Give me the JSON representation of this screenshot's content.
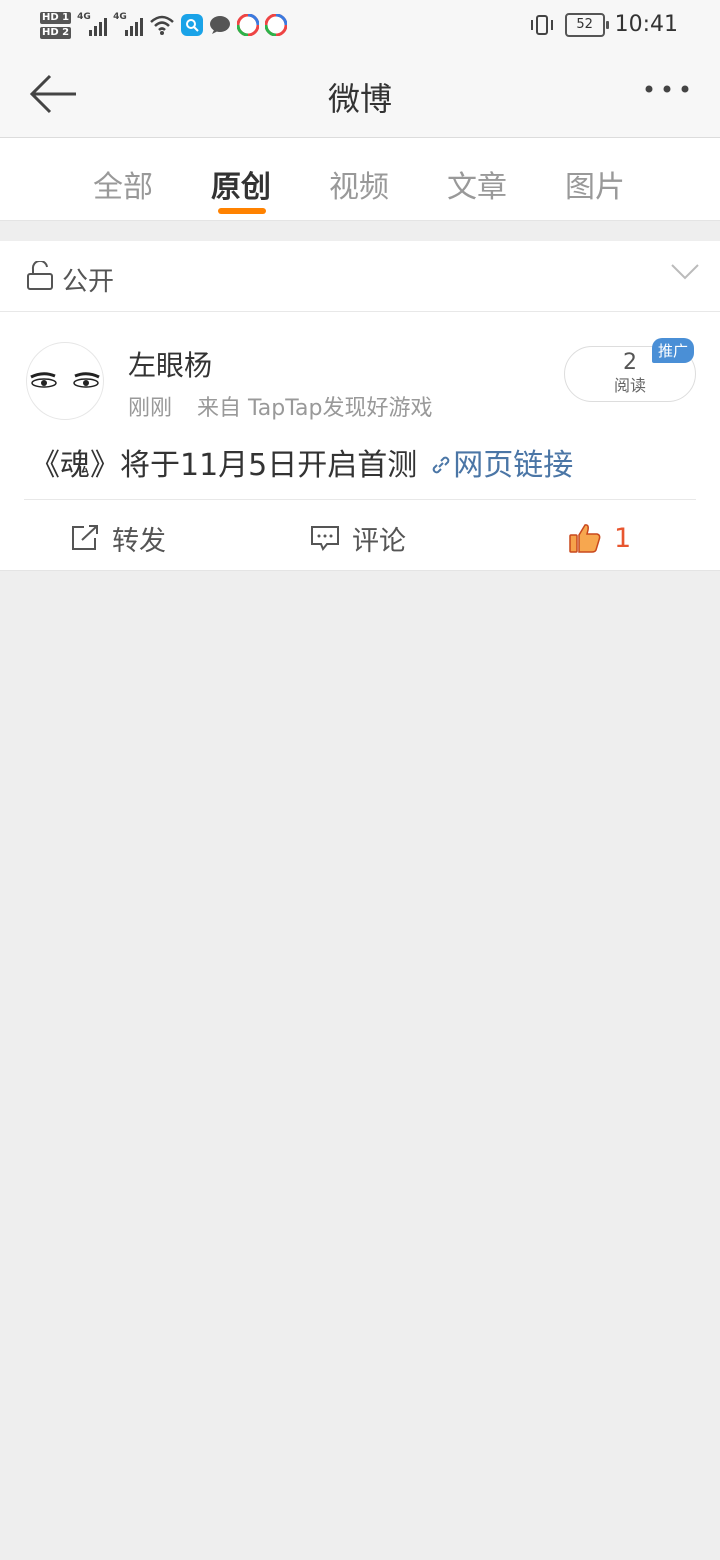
{
  "status_bar": {
    "sim1": "HD 1",
    "sim2": "HD 2",
    "net1": "4G",
    "net2": "4G",
    "battery": "52",
    "time": "10:41"
  },
  "nav": {
    "title": "微博",
    "back_icon": "back-arrow-icon",
    "more_icon": "more-dots-icon"
  },
  "tabs": [
    {
      "label": "全部"
    },
    {
      "label": "原创"
    },
    {
      "label": "视频"
    },
    {
      "label": "文章"
    },
    {
      "label": "图片"
    }
  ],
  "active_tab": "原创",
  "privacy": {
    "label": "公开",
    "icon": "unlock-icon"
  },
  "post": {
    "username": "左眼杨",
    "time": "刚刚",
    "source": "来自 TapTap发现好游戏",
    "read_count": "2",
    "read_label": "阅读",
    "promo_badge": "推广",
    "text": "《魂》将于11月5日开启首测",
    "link_text": "网页链接",
    "actions": {
      "repost_label": "转发",
      "comment_label": "评论",
      "like_count": "1"
    }
  },
  "colors": {
    "accent": "#ff8200",
    "link": "#4b76a6",
    "like": "#e8562f",
    "promo": "#4a8fd6"
  }
}
